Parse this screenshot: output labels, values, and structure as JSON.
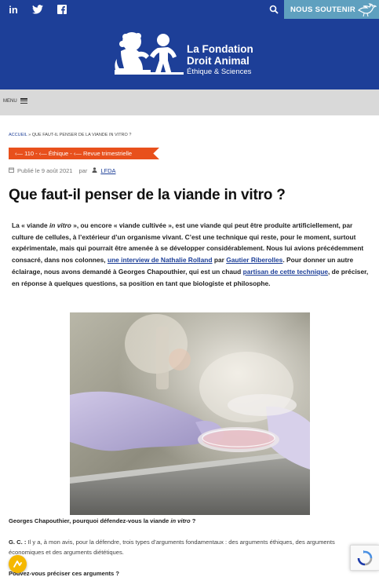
{
  "topbar": {
    "social": [
      {
        "icon": "linkedin-icon",
        "glyph": "in"
      },
      {
        "icon": "twitter-icon"
      },
      {
        "icon": "facebook-icon"
      }
    ],
    "search_icon": "search-icon",
    "donate_label": "NOUS SOUTENIR",
    "bird_icon": "bird-icon"
  },
  "header": {
    "logo": {
      "line1": "La Fondation",
      "line2": "Droit Animal",
      "line3": "Éthique & Sciences"
    }
  },
  "menu": {
    "label": "MENU",
    "icon": "hamburger-icon"
  },
  "breadcrumb": {
    "home": "ACCUEIL",
    "current": "» QUE FAUT-IL PENSER DE LA VIANDE IN VITRO ?"
  },
  "tags": "‹— 110 - ‹— Éthique - ‹— Revue trimestrielle",
  "meta": {
    "published": "Publié le 9 août 2021",
    "by": "par",
    "author": "LFDA"
  },
  "article": {
    "title": "Que faut-il penser de la viande in vitro ?",
    "lede": {
      "p1_a": "La « viande ",
      "p1_em": "in vitro",
      "p1_b": " », ou encore « viande cultivée », est une viande qui peut être produite artificiellement, par culture de cellules, à l’extérieur d’un organisme vivant. C’est une technique qui reste, pour le moment, surtout expérimentale, mais qui pourrait être amenée à se développer considérablement. Nous lui avions précédemment consacré, dans nos colonnes, ",
      "link1": "une interview de Nathalie Rolland",
      "p1_c": " par ",
      "link2": "Gautier Riberolles",
      "p1_d": ". Pour donner un autre éclairage, nous avons demandé à Georges Chapouthier, qui est un chaud ",
      "link3": "partisan de cette technique",
      "p1_e": ", de préciser, en réponse à quelques questions, sa position en tant que biologiste et philosophe."
    },
    "q1_a": "Georges Chapouthier, pourquoi défendez-vous la viande ",
    "q1_em": "in vitro",
    "q1_b": " ?",
    "answer_label": "G. C. :",
    "answer_text": " Il y a, à mon avis, pour la défendre, trois types d’arguments fondamentaux : des arguments éthiques, des arguments économiques et des arguments diététiques.",
    "q2": "Pouvez-vous préciser ces arguments ?"
  },
  "colors": {
    "brand_blue": "#1d3f98",
    "donate_blue": "#5fa0bf",
    "tag_orange": "#e8501c",
    "accessibility_yellow": "#f5b800"
  }
}
